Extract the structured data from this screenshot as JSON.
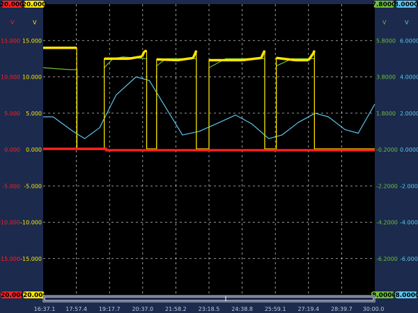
{
  "colors": {
    "background": "#1b2a4d",
    "plot": "#000000",
    "grid": "#c8c8c8",
    "red": "#ff2020",
    "yellow": "#ffe600",
    "green": "#6fbf3a",
    "cyan": "#5cc8f0",
    "axis_text": "#c0c8d8"
  },
  "scale_badges": {
    "red_top": "20.000",
    "yellow_top": "20.000",
    "green_top": "7.8000",
    "cyan_top": "8.0000",
    "red_bottom": "-20.000",
    "yellow_bottom": "-20.000",
    "green_bottom": "-8.0000",
    "cyan_bottom": "-8.0000"
  },
  "units": {
    "red": "V",
    "yellow": "V",
    "green": "V",
    "cyan": "V"
  },
  "chart_data": {
    "type": "line",
    "grid": true,
    "x_ticks": [
      "16:37.1",
      "17:57.4",
      "19:17.7",
      "20:37.0",
      "21:58.2",
      "23:18.5",
      "24:38.8",
      "25:59.1",
      "27:19.4",
      "28:39.7",
      "30:00.0"
    ],
    "left_ticks": [
      "15.000",
      "10.000",
      "5.000",
      "0.000",
      "-5.000",
      "-10.000",
      "-15.000"
    ],
    "right_green_ticks": [
      "5.8000",
      "3.8000",
      "1.8000",
      "-0.2000",
      "-2.2000",
      "-4.2000",
      "-6.2000"
    ],
    "right_cyan_ticks": [
      "6.0000",
      "4.0000",
      "2.0000",
      "0.0000",
      "-2.0000",
      "-4.0000",
      "-6.0000"
    ],
    "ylim_left": [
      -20,
      20
    ],
    "ylim_green": [
      -8.2,
      7.8
    ],
    "ylim_cyan": [
      -8,
      8
    ],
    "xlim": [
      0,
      10
    ],
    "series": [
      {
        "key": "red",
        "axis": "left",
        "points": [
          [
            0,
            0.1
          ],
          [
            1.9,
            0.1
          ],
          [
            1.9,
            -0.1
          ],
          [
            10,
            -0.1
          ]
        ]
      },
      {
        "key": "yellow",
        "axis": "left",
        "points": [
          [
            0,
            14.0
          ],
          [
            1.01,
            14.0
          ],
          [
            1.01,
            0.1
          ],
          [
            1.84,
            0.1
          ],
          [
            1.84,
            12.5
          ],
          [
            2.58,
            12.5
          ],
          [
            2.98,
            12.8
          ],
          [
            3.05,
            13.5
          ],
          [
            3.12,
            13.6
          ],
          [
            3.12,
            0.1
          ],
          [
            3.42,
            0.1
          ],
          [
            3.42,
            12.4
          ],
          [
            4.06,
            12.3
          ],
          [
            4.52,
            12.6
          ],
          [
            4.58,
            13.2
          ],
          [
            4.62,
            13.6
          ],
          [
            4.62,
            0.1
          ],
          [
            5.0,
            0.1
          ],
          [
            5.0,
            12.3
          ],
          [
            6.0,
            12.3
          ],
          [
            6.58,
            12.6
          ],
          [
            6.63,
            13.2
          ],
          [
            6.68,
            13.6
          ],
          [
            6.68,
            0.1
          ],
          [
            7.03,
            0.1
          ],
          [
            7.03,
            12.6
          ],
          [
            7.6,
            12.3
          ],
          [
            8.0,
            12.3
          ],
          [
            8.14,
            13.2
          ],
          [
            8.18,
            13.6
          ],
          [
            8.18,
            0.1
          ],
          [
            10,
            0.1
          ]
        ]
      },
      {
        "key": "green",
        "axis": "green",
        "points": [
          [
            0,
            4.3
          ],
          [
            0.8,
            4.2
          ],
          [
            1.02,
            4.2
          ],
          [
            1.02,
            -0.2
          ],
          [
            1.84,
            -0.2
          ],
          [
            1.84,
            4.3
          ],
          [
            2.1,
            4.8
          ],
          [
            2.4,
            4.9
          ],
          [
            3.12,
            4.8
          ],
          [
            3.12,
            -0.2
          ],
          [
            3.42,
            -0.2
          ],
          [
            3.42,
            4.4
          ],
          [
            3.7,
            4.8
          ],
          [
            4.0,
            4.8
          ],
          [
            4.62,
            4.8
          ],
          [
            4.62,
            -0.2
          ],
          [
            5.0,
            -0.2
          ],
          [
            5.0,
            4.3
          ],
          [
            5.5,
            4.8
          ],
          [
            6.0,
            4.8
          ],
          [
            6.68,
            4.8
          ],
          [
            6.68,
            -0.2
          ],
          [
            7.03,
            -0.2
          ],
          [
            7.03,
            4.4
          ],
          [
            7.5,
            4.8
          ],
          [
            8.18,
            4.8
          ],
          [
            8.18,
            -0.2
          ],
          [
            10,
            -0.2
          ]
        ]
      },
      {
        "key": "cyan",
        "axis": "cyan",
        "points": [
          [
            0,
            1.8
          ],
          [
            0.3,
            1.8
          ],
          [
            0.9,
            1.0
          ],
          [
            1.25,
            0.6
          ],
          [
            1.7,
            1.2
          ],
          [
            2.2,
            3.0
          ],
          [
            2.8,
            4.0
          ],
          [
            3.2,
            3.8
          ],
          [
            3.8,
            2.0
          ],
          [
            4.2,
            0.8
          ],
          [
            4.7,
            1.0
          ],
          [
            5.2,
            1.4
          ],
          [
            5.8,
            1.9
          ],
          [
            6.3,
            1.4
          ],
          [
            6.8,
            0.6
          ],
          [
            7.2,
            0.8
          ],
          [
            7.7,
            1.5
          ],
          [
            8.2,
            2.0
          ],
          [
            8.6,
            1.8
          ],
          [
            9.1,
            1.1
          ],
          [
            9.5,
            0.9
          ],
          [
            10,
            2.5
          ]
        ]
      }
    ]
  }
}
